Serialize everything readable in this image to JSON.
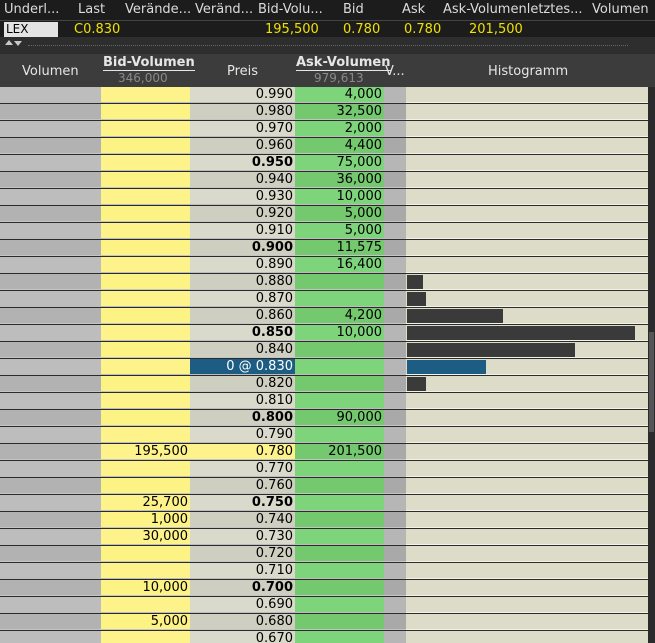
{
  "ticker_header": {
    "columns": [
      "Underl...",
      "Last",
      "Verände...",
      "Veränd...",
      "Bid-Volu...",
      "Bid",
      "Ask",
      "Ask-Volumenletztes...",
      "Volumen"
    ]
  },
  "ticker": {
    "symbol": "LEX",
    "last": "C0.830",
    "bid_volume": "195,500",
    "bid": "0.780",
    "ask": "0.780",
    "ask_volume": "201,500"
  },
  "book_header": {
    "volumen": "Volumen",
    "bid_volumen": "Bid-Volumen",
    "bid_volumen_total": "346,000",
    "preis": "Preis",
    "ask_volumen": "Ask-Volumen",
    "ask_volumen_total": "979,613",
    "v": "V...",
    "histogramm": "Histogramm"
  },
  "colors": {
    "bid_yellow": "#fdf38a",
    "ask_green": "#7ed47a",
    "ask_green_dark": "#74c96f",
    "highlight_blue": "#1d5c83",
    "hist_bg": "#dcdcc8"
  },
  "rows": [
    {
      "price": "0.990",
      "bid": "",
      "ask": "4,000",
      "bold": false,
      "hist": 0
    },
    {
      "price": "0.980",
      "bid": "",
      "ask": "32,500",
      "bold": false,
      "hist": 0
    },
    {
      "price": "0.970",
      "bid": "",
      "ask": "2,000",
      "bold": false,
      "hist": 0
    },
    {
      "price": "0.960",
      "bid": "",
      "ask": "4,400",
      "bold": false,
      "hist": 0
    },
    {
      "price": "0.950",
      "bid": "",
      "ask": "75,000",
      "bold": true,
      "hist": 0
    },
    {
      "price": "0.940",
      "bid": "",
      "ask": "36,000",
      "bold": false,
      "hist": 0
    },
    {
      "price": "0.930",
      "bid": "",
      "ask": "10,000",
      "bold": false,
      "hist": 0
    },
    {
      "price": "0.920",
      "bid": "",
      "ask": "5,000",
      "bold": false,
      "hist": 0
    },
    {
      "price": "0.910",
      "bid": "",
      "ask": "5,000",
      "bold": false,
      "hist": 0
    },
    {
      "price": "0.900",
      "bid": "",
      "ask": "11,575",
      "bold": true,
      "hist": 0
    },
    {
      "price": "0.890",
      "bid": "",
      "ask": "16,400",
      "bold": false,
      "hist": 0
    },
    {
      "price": "0.880",
      "bid": "",
      "ask": "",
      "bold": false,
      "hist": 0.065
    },
    {
      "price": "0.870",
      "bid": "",
      "ask": "",
      "bold": false,
      "hist": 0.08
    },
    {
      "price": "0.860",
      "bid": "",
      "ask": "4,200",
      "bold": false,
      "hist": 0.4
    },
    {
      "price": "0.850",
      "bid": "",
      "ask": "10,000",
      "bold": true,
      "hist": 0.95
    },
    {
      "price": "0.840",
      "bid": "",
      "ask": "",
      "bold": false,
      "hist": 0.7
    },
    {
      "price": "0 @ 0.830",
      "bid": "",
      "ask": "",
      "bold": false,
      "hist": 0.33,
      "current": true
    },
    {
      "price": "0.820",
      "bid": "",
      "ask": "",
      "bold": false,
      "hist": 0.08
    },
    {
      "price": "0.810",
      "bid": "",
      "ask": "",
      "bold": false,
      "hist": 0
    },
    {
      "price": "0.800",
      "bid": "",
      "ask": "90,000",
      "bold": true,
      "hist": 0
    },
    {
      "price": "0.790",
      "bid": "",
      "ask": "",
      "bold": false,
      "hist": 0
    },
    {
      "price": "0.780",
      "bid": "195,500",
      "ask": "201,500",
      "bold": false,
      "hist": 0,
      "bbo": true
    },
    {
      "price": "0.770",
      "bid": "",
      "ask": "",
      "bold": false,
      "hist": 0
    },
    {
      "price": "0.760",
      "bid": "",
      "ask": "",
      "bold": false,
      "hist": 0
    },
    {
      "price": "0.750",
      "bid": "25,700",
      "ask": "",
      "bold": true,
      "hist": 0
    },
    {
      "price": "0.740",
      "bid": "1,000",
      "ask": "",
      "bold": false,
      "hist": 0
    },
    {
      "price": "0.730",
      "bid": "30,000",
      "ask": "",
      "bold": false,
      "hist": 0
    },
    {
      "price": "0.720",
      "bid": "",
      "ask": "",
      "bold": false,
      "hist": 0
    },
    {
      "price": "0.710",
      "bid": "",
      "ask": "",
      "bold": false,
      "hist": 0
    },
    {
      "price": "0.700",
      "bid": "10,000",
      "ask": "",
      "bold": true,
      "hist": 0
    },
    {
      "price": "0.690",
      "bid": "",
      "ask": "",
      "bold": false,
      "hist": 0
    },
    {
      "price": "0.680",
      "bid": "5,000",
      "ask": "",
      "bold": false,
      "hist": 0
    },
    {
      "price": "0.670",
      "bid": "",
      "ask": "",
      "bold": false,
      "hist": 0
    }
  ]
}
